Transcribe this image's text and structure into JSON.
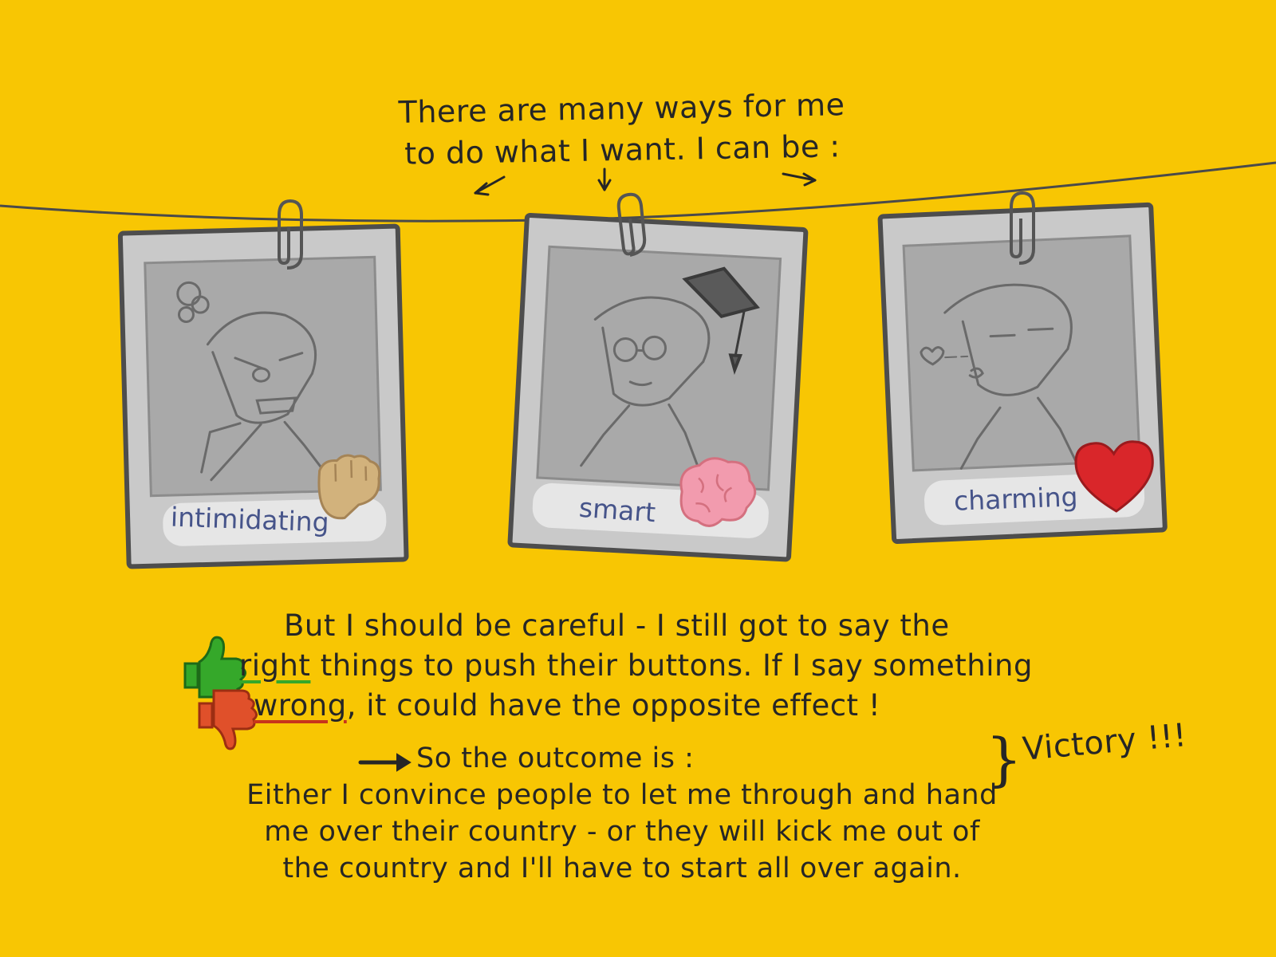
{
  "intro": {
    "line1": "There are many ways for me",
    "line2": "to do what I want. I can be :"
  },
  "cards": [
    {
      "caption": "intimidating",
      "icon": "fist-icon"
    },
    {
      "caption": "smart",
      "icon": "brain-icon"
    },
    {
      "caption": "charming",
      "icon": "heart-icon"
    }
  ],
  "body": {
    "line1": "But I should be careful - I still got to say the",
    "right_word": "right",
    "line2_rest": " things to push their buttons. If I say something",
    "wrong_word": "wrong",
    "line3_rest": ", it could have the opposite effect !"
  },
  "outcome": {
    "lead": "So the outcome is :",
    "line1": "Either I convince people to let me through and hand",
    "line2": "me over their country - or they will kick me out of",
    "line3": "the country and I'll have to start all over again."
  },
  "victory": "Victory !!!",
  "colors": {
    "background": "#f8c603",
    "frame": "#c9c9c9",
    "photo": "#a9a9a9",
    "caption_text": "#46548a",
    "thumb_up": "#35a82a",
    "thumb_down": "#e0502a",
    "heart": "#d9262a",
    "brain": "#f29bae",
    "fist": "#d2b27c"
  }
}
